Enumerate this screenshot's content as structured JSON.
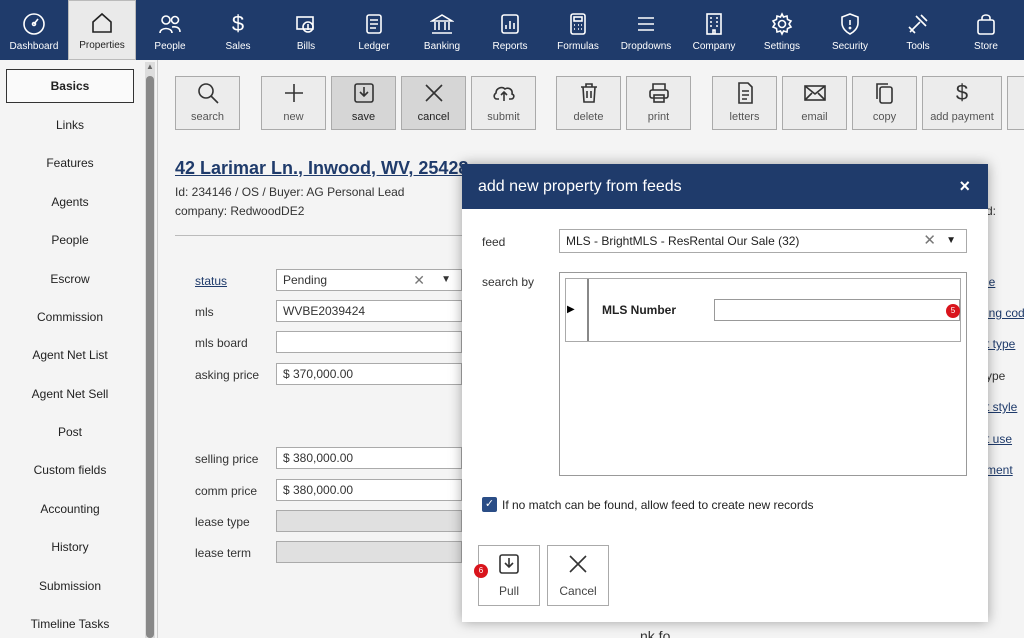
{
  "nav": [
    {
      "label": "Dashboard",
      "icon": "gauge-icon"
    },
    {
      "label": "Properties",
      "icon": "house-icon",
      "active": true
    },
    {
      "label": "People",
      "icon": "people-icon"
    },
    {
      "label": "Sales",
      "icon": "dollar-icon"
    },
    {
      "label": "Bills",
      "icon": "bills-icon"
    },
    {
      "label": "Ledger",
      "icon": "ledger-icon"
    },
    {
      "label": "Banking",
      "icon": "bank-icon"
    },
    {
      "label": "Reports",
      "icon": "report-icon"
    },
    {
      "label": "Formulas",
      "icon": "calculator-icon"
    },
    {
      "label": "Dropdowns",
      "icon": "list-icon"
    },
    {
      "label": "Company",
      "icon": "building-icon"
    },
    {
      "label": "Settings",
      "icon": "gear-icon"
    },
    {
      "label": "Security",
      "icon": "shield-icon"
    },
    {
      "label": "Tools",
      "icon": "tools-icon"
    },
    {
      "label": "Store",
      "icon": "bag-icon"
    }
  ],
  "sidebar": {
    "items": [
      {
        "label": "Basics",
        "active": true
      },
      {
        "label": "Links"
      },
      {
        "label": "Features"
      },
      {
        "label": "Agents"
      },
      {
        "label": "People"
      },
      {
        "label": "Escrow"
      },
      {
        "label": "Commission"
      },
      {
        "label": "Agent Net List"
      },
      {
        "label": "Agent Net Sell"
      },
      {
        "label": "Post"
      },
      {
        "label": "Custom fields"
      },
      {
        "label": "Accounting"
      },
      {
        "label": "History"
      },
      {
        "label": "Submission"
      },
      {
        "label": "Timeline Tasks"
      }
    ]
  },
  "toolbar": {
    "search": "search",
    "new": "new",
    "save": "save",
    "cancel": "cancel",
    "submit": "submit",
    "delete": "delete",
    "print": "print",
    "letters": "letters",
    "email": "email",
    "copy": "copy",
    "add_payment": "add payment"
  },
  "property": {
    "title": "42 Larimar Ln., Inwood, WV, 25428",
    "id_line": "Id: 234146 / OS / Buyer: AG Personal Lead",
    "company_line": "company: RedwoodDE2",
    "right_cut": "d:"
  },
  "form": {
    "status_label": "status",
    "status_value": "Pending",
    "mls_label": "mls",
    "mls_value": "WVBE2039424",
    "mls_board_label": "mls board",
    "asking_price_label": "asking price",
    "asking_price_value": "$ 370,000.00",
    "selling_price_label": "selling price",
    "selling_price_value": "$ 380,000.00",
    "comm_price_label": "comm price",
    "comm_price_value": "$ 380,000.00",
    "lease_type_label": "lease type",
    "lease_term_label": "lease term"
  },
  "right_fragments": [
    "le",
    "ing cod",
    "t type",
    "ype",
    "t style",
    "t use",
    "ment"
  ],
  "bottom_fragment": "nk fo",
  "modal": {
    "title": "add new property from feeds",
    "close": "×",
    "feed_label": "feed",
    "feed_value": "MLS - BrightMLS - ResRental Our Sale (32)",
    "search_by_label": "search by",
    "mls_number_label": "MLS Number",
    "mls_number_value": "",
    "badge_5": "5",
    "badge_6": "6",
    "checkbox_label": "If no match can be found, allow feed to create new records",
    "checkbox_checked": true,
    "pull_label": "Pull",
    "cancel_label": "Cancel"
  },
  "colors": {
    "nav_bg": "#1f3b6b",
    "modal_header": "#1f3b6b",
    "badge": "#d9141c",
    "checkbox": "#2a4d86"
  }
}
